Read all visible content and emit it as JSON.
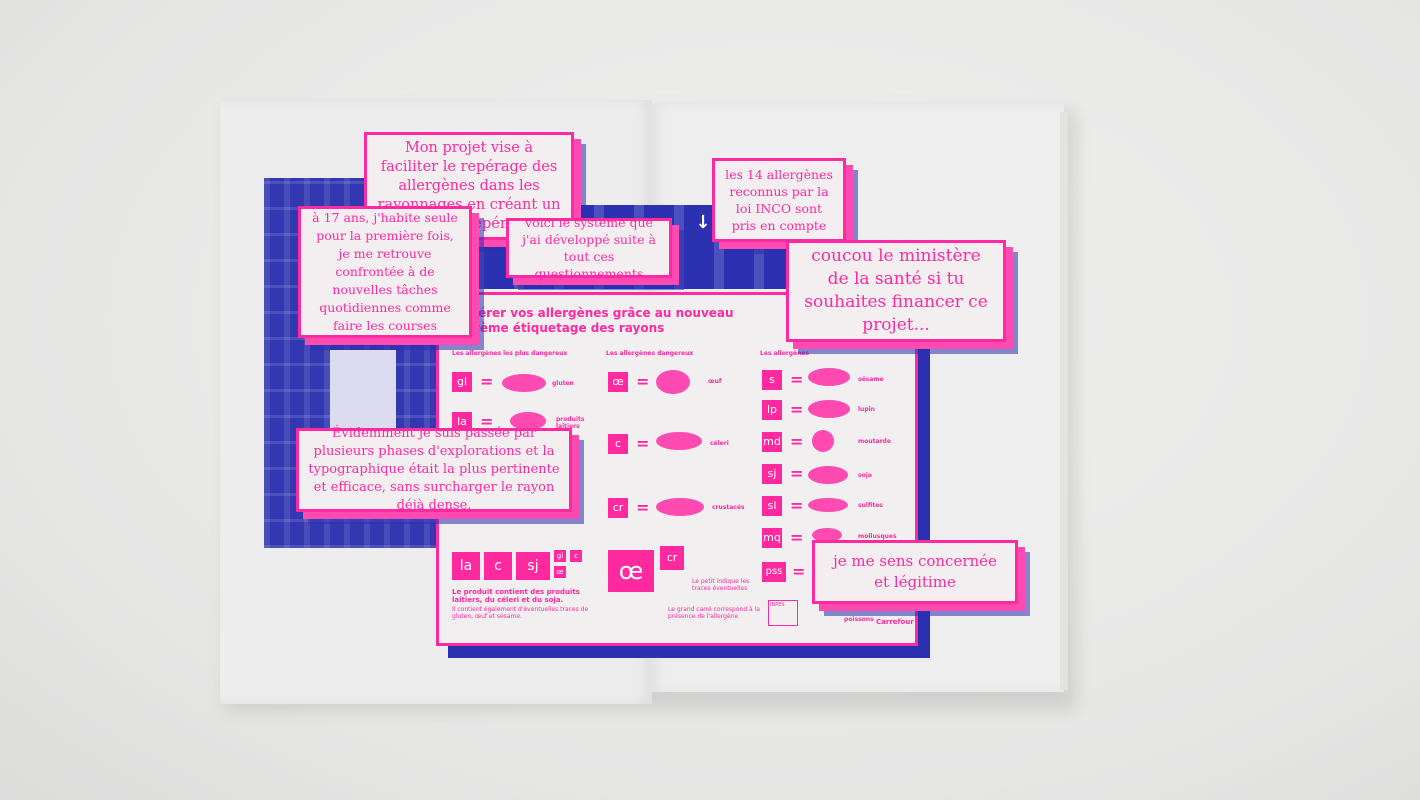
{
  "colors": {
    "pink": "#ff2aa0",
    "blue": "#2a30b0",
    "paper": "#eeeded"
  },
  "cards": {
    "project": "Mon projet vise à faciliter le repérage des allergènes dans les rayonnages en créant un code de repérage",
    "age": "à 17 ans, j'habite seule pour la première fois, je me retrouve confrontée à de nouvelles tâches quotidiennes comme faire les courses",
    "system": "voici le système que j'ai développé suite à tout ces questionnements",
    "allergens14": "les 14 allergènes reconnus par la loi INCO sont pris en compte",
    "ministry": "coucou le ministère de la santé si tu souhaites financer ce projet...",
    "explorations": "Évidemment je suis passée par plusieurs phases d'explorations et la typographique était la plus pertinente et efficace, sans surcharger le rayon déjà dense.",
    "concerned": "je me sens concernée et légitime"
  },
  "poster": {
    "title": "Repérer vos allergènes grâce au nouveau système étiquetage des rayons",
    "columns": [
      "Les allergènes les plus dangereux",
      "Les allergènes dangereux",
      "Les allergènes"
    ],
    "col1": [
      {
        "code": "gl",
        "label": "gluten"
      },
      {
        "code": "la",
        "label": "produits laitiers"
      }
    ],
    "col2": [
      {
        "code": "œ",
        "label": "œuf"
      },
      {
        "code": "c",
        "label": "céleri"
      },
      {
        "code": "cr",
        "label": "crustacés"
      }
    ],
    "col3": [
      {
        "code": "s",
        "label": "sésame"
      },
      {
        "code": "lp",
        "label": "lupin"
      },
      {
        "code": "md",
        "label": "moutarde"
      },
      {
        "code": "sj",
        "label": "soja"
      },
      {
        "code": "sl",
        "label": "sulfites"
      },
      {
        "code": "mq",
        "label": "mollusques"
      },
      {
        "code": "pss",
        "label": "poissons"
      }
    ],
    "example_codes": [
      "la",
      "c",
      "sj"
    ],
    "example_small": [
      "gl",
      "c",
      "œ"
    ],
    "example_caption": "Le produit contient des produits laitiers, du céleri et du soja.",
    "example_caption2": "Il contient également d'éventuelles traces de gluten, œuf et sésame.",
    "big_code": "œ",
    "small_code": "cr",
    "legend_small": "Le petit indique les traces éventuelles",
    "legend_big": "Le grand carré correspond à la présence de l'allergène",
    "brand": "Carrefour",
    "stamp": "INPES"
  },
  "sign_arrow": "↓"
}
